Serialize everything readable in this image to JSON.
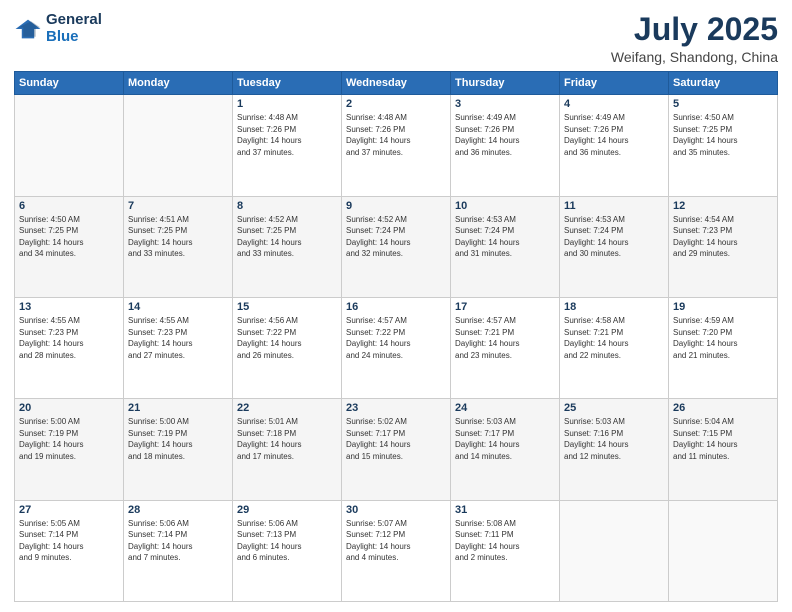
{
  "header": {
    "logo_general": "General",
    "logo_blue": "Blue",
    "month_title": "July 2025",
    "subtitle": "Weifang, Shandong, China"
  },
  "weekdays": [
    "Sunday",
    "Monday",
    "Tuesday",
    "Wednesday",
    "Thursday",
    "Friday",
    "Saturday"
  ],
  "weeks": [
    [
      {
        "day": "",
        "info": ""
      },
      {
        "day": "",
        "info": ""
      },
      {
        "day": "1",
        "info": "Sunrise: 4:48 AM\nSunset: 7:26 PM\nDaylight: 14 hours\nand 37 minutes."
      },
      {
        "day": "2",
        "info": "Sunrise: 4:48 AM\nSunset: 7:26 PM\nDaylight: 14 hours\nand 37 minutes."
      },
      {
        "day": "3",
        "info": "Sunrise: 4:49 AM\nSunset: 7:26 PM\nDaylight: 14 hours\nand 36 minutes."
      },
      {
        "day": "4",
        "info": "Sunrise: 4:49 AM\nSunset: 7:26 PM\nDaylight: 14 hours\nand 36 minutes."
      },
      {
        "day": "5",
        "info": "Sunrise: 4:50 AM\nSunset: 7:25 PM\nDaylight: 14 hours\nand 35 minutes."
      }
    ],
    [
      {
        "day": "6",
        "info": "Sunrise: 4:50 AM\nSunset: 7:25 PM\nDaylight: 14 hours\nand 34 minutes."
      },
      {
        "day": "7",
        "info": "Sunrise: 4:51 AM\nSunset: 7:25 PM\nDaylight: 14 hours\nand 33 minutes."
      },
      {
        "day": "8",
        "info": "Sunrise: 4:52 AM\nSunset: 7:25 PM\nDaylight: 14 hours\nand 33 minutes."
      },
      {
        "day": "9",
        "info": "Sunrise: 4:52 AM\nSunset: 7:24 PM\nDaylight: 14 hours\nand 32 minutes."
      },
      {
        "day": "10",
        "info": "Sunrise: 4:53 AM\nSunset: 7:24 PM\nDaylight: 14 hours\nand 31 minutes."
      },
      {
        "day": "11",
        "info": "Sunrise: 4:53 AM\nSunset: 7:24 PM\nDaylight: 14 hours\nand 30 minutes."
      },
      {
        "day": "12",
        "info": "Sunrise: 4:54 AM\nSunset: 7:23 PM\nDaylight: 14 hours\nand 29 minutes."
      }
    ],
    [
      {
        "day": "13",
        "info": "Sunrise: 4:55 AM\nSunset: 7:23 PM\nDaylight: 14 hours\nand 28 minutes."
      },
      {
        "day": "14",
        "info": "Sunrise: 4:55 AM\nSunset: 7:23 PM\nDaylight: 14 hours\nand 27 minutes."
      },
      {
        "day": "15",
        "info": "Sunrise: 4:56 AM\nSunset: 7:22 PM\nDaylight: 14 hours\nand 26 minutes."
      },
      {
        "day": "16",
        "info": "Sunrise: 4:57 AM\nSunset: 7:22 PM\nDaylight: 14 hours\nand 24 minutes."
      },
      {
        "day": "17",
        "info": "Sunrise: 4:57 AM\nSunset: 7:21 PM\nDaylight: 14 hours\nand 23 minutes."
      },
      {
        "day": "18",
        "info": "Sunrise: 4:58 AM\nSunset: 7:21 PM\nDaylight: 14 hours\nand 22 minutes."
      },
      {
        "day": "19",
        "info": "Sunrise: 4:59 AM\nSunset: 7:20 PM\nDaylight: 14 hours\nand 21 minutes."
      }
    ],
    [
      {
        "day": "20",
        "info": "Sunrise: 5:00 AM\nSunset: 7:19 PM\nDaylight: 14 hours\nand 19 minutes."
      },
      {
        "day": "21",
        "info": "Sunrise: 5:00 AM\nSunset: 7:19 PM\nDaylight: 14 hours\nand 18 minutes."
      },
      {
        "day": "22",
        "info": "Sunrise: 5:01 AM\nSunset: 7:18 PM\nDaylight: 14 hours\nand 17 minutes."
      },
      {
        "day": "23",
        "info": "Sunrise: 5:02 AM\nSunset: 7:17 PM\nDaylight: 14 hours\nand 15 minutes."
      },
      {
        "day": "24",
        "info": "Sunrise: 5:03 AM\nSunset: 7:17 PM\nDaylight: 14 hours\nand 14 minutes."
      },
      {
        "day": "25",
        "info": "Sunrise: 5:03 AM\nSunset: 7:16 PM\nDaylight: 14 hours\nand 12 minutes."
      },
      {
        "day": "26",
        "info": "Sunrise: 5:04 AM\nSunset: 7:15 PM\nDaylight: 14 hours\nand 11 minutes."
      }
    ],
    [
      {
        "day": "27",
        "info": "Sunrise: 5:05 AM\nSunset: 7:14 PM\nDaylight: 14 hours\nand 9 minutes."
      },
      {
        "day": "28",
        "info": "Sunrise: 5:06 AM\nSunset: 7:14 PM\nDaylight: 14 hours\nand 7 minutes."
      },
      {
        "day": "29",
        "info": "Sunrise: 5:06 AM\nSunset: 7:13 PM\nDaylight: 14 hours\nand 6 minutes."
      },
      {
        "day": "30",
        "info": "Sunrise: 5:07 AM\nSunset: 7:12 PM\nDaylight: 14 hours\nand 4 minutes."
      },
      {
        "day": "31",
        "info": "Sunrise: 5:08 AM\nSunset: 7:11 PM\nDaylight: 14 hours\nand 2 minutes."
      },
      {
        "day": "",
        "info": ""
      },
      {
        "day": "",
        "info": ""
      }
    ]
  ]
}
